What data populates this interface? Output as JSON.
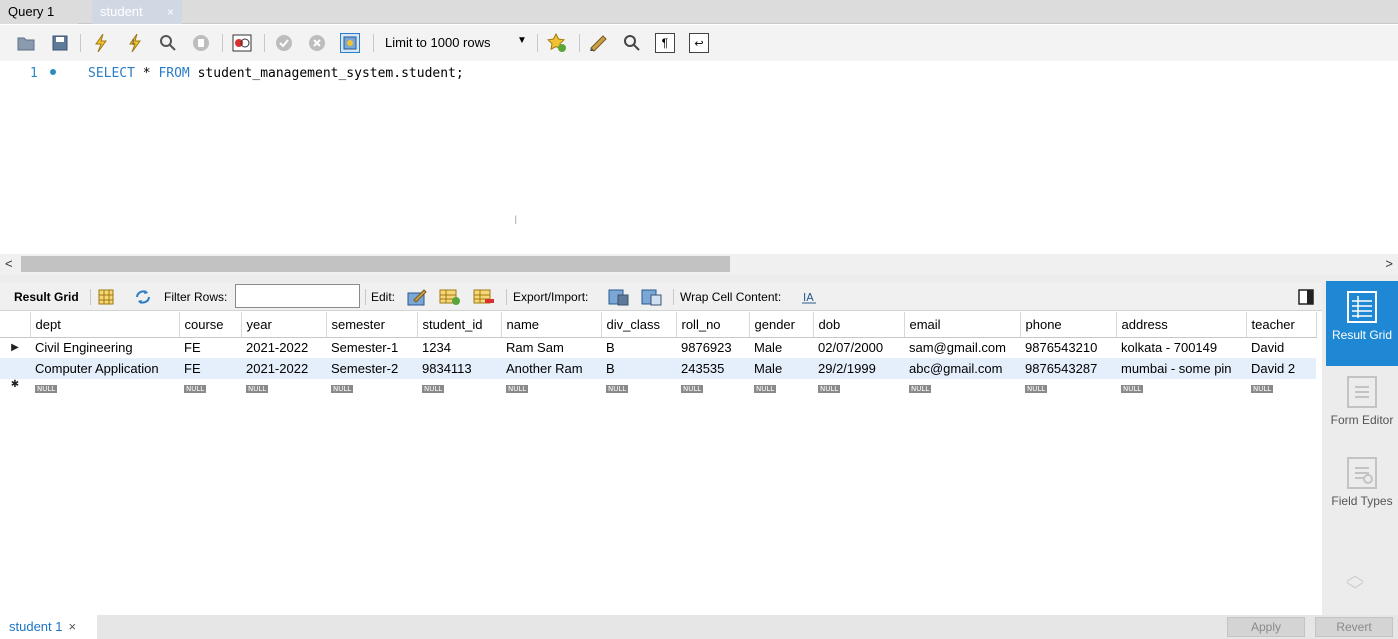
{
  "tabs": [
    {
      "label": "Query 1"
    },
    {
      "label": "student",
      "close": "×"
    }
  ],
  "toolbar": {
    "limit_label": "Limit to 1000 rows",
    "icons": [
      "open-file-icon",
      "save-icon",
      "execute-icon",
      "execute-current-icon",
      "explain-icon",
      "stop-icon",
      "toggle-error-icon",
      "commit-icon",
      "rollback-icon",
      "autocommit-icon",
      "bookmark-icon",
      "beautify-icon",
      "find-icon",
      "invisible-chars-icon",
      "wrap-icon"
    ]
  },
  "editor": {
    "line_number": "1",
    "keyword_select": "SELECT",
    "star": " * ",
    "keyword_from": "FROM",
    "target": " student_management_system.student;"
  },
  "result_toolbar": {
    "result_grid_label": "Result Grid",
    "filter_label": "Filter Rows:",
    "filter_value": "",
    "edit_label": "Edit:",
    "export_label": "Export/Import:",
    "wrap_label": "Wrap Cell Content:"
  },
  "grid": {
    "columns": [
      "dept",
      "course",
      "year",
      "semester",
      "student_id",
      "name",
      "div_class",
      "roll_no",
      "gender",
      "dob",
      "email",
      "phone",
      "address",
      "teacher"
    ],
    "rows": [
      [
        "Civil Engineering",
        "FE",
        "2021-2022",
        "Semester-1",
        "1234",
        "Ram Sam",
        "B",
        "9876923",
        "Male",
        "02/07/2000",
        "sam@gmail.com",
        "9876543210",
        "kolkata - 700149",
        "David"
      ],
      [
        "Computer Application",
        "FE",
        "2021-2022",
        "Semester-2",
        "9834113",
        "Another Ram",
        "B",
        "243535",
        "Male",
        "29/2/1999",
        "abc@gmail.com",
        "9876543287",
        "mumbai - some pin",
        "David 2"
      ]
    ],
    "null_label": "NULL",
    "row_marker": "▶",
    "new_row_marker": "✱"
  },
  "side_panel": {
    "result_grid": "Result Grid",
    "form_editor": "Form Editor",
    "field_types": "Field Types"
  },
  "bottom": {
    "result_tab": "student 1",
    "close": "×",
    "apply": "Apply",
    "revert": "Revert"
  },
  "colors": {
    "accent": "#1e88d4",
    "keyword": "#2a7dc7",
    "selected_row": "#e5eefb"
  }
}
